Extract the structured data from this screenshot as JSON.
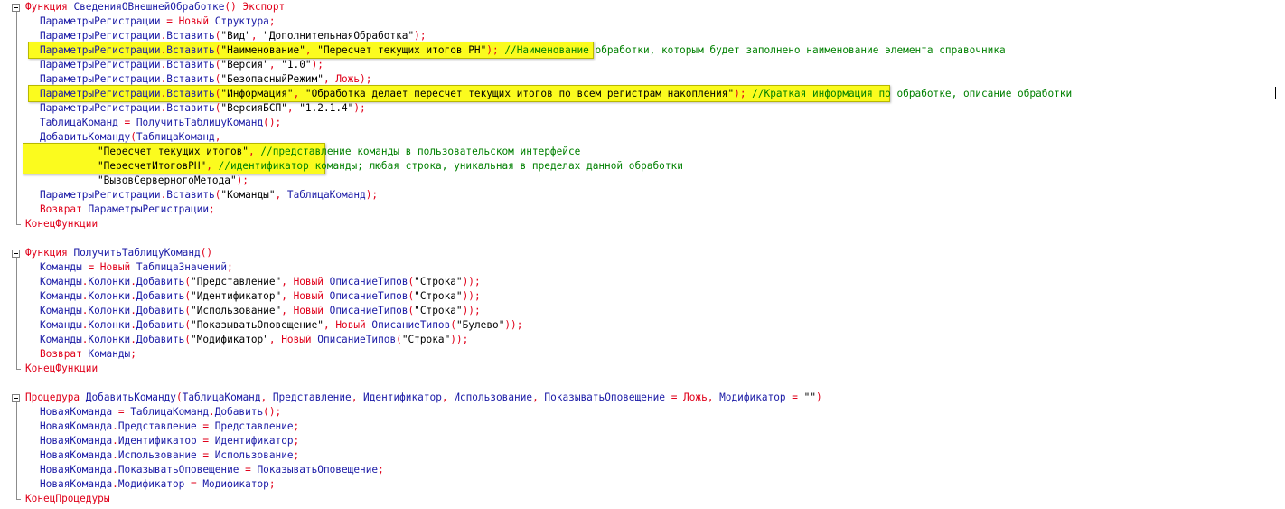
{
  "lines": [
    [
      [
        "kw",
        "Функция "
      ],
      [
        "id",
        "СведенияОВнешнейОбработке"
      ],
      [
        "op",
        "() "
      ],
      [
        "kw",
        "Экспорт"
      ]
    ],
    [
      [
        "id",
        "ПараметрыРегистрации "
      ],
      [
        "op",
        "= "
      ],
      [
        "kw",
        "Новый "
      ],
      [
        "id",
        "Структура"
      ],
      [
        "op",
        ";"
      ]
    ],
    [
      [
        "id",
        "ПараметрыРегистрации"
      ],
      [
        "op",
        "."
      ],
      [
        "id",
        "Вставить"
      ],
      [
        "op",
        "("
      ],
      [
        "str",
        "\"Вид\""
      ],
      [
        "op",
        ", "
      ],
      [
        "str",
        "\"ДополнительнаяОбработка\""
      ],
      [
        "op",
        ");"
      ]
    ],
    [
      [
        "id",
        "ПараметрыРегистрации"
      ],
      [
        "op",
        "."
      ],
      [
        "id",
        "Вставить"
      ],
      [
        "op",
        "("
      ],
      [
        "str",
        "\"Наименование\""
      ],
      [
        "op",
        ", "
      ],
      [
        "str",
        "\"Пересчет текущих итогов РН\""
      ],
      [
        "op",
        ");"
      ],
      [
        "cm",
        " //Наименование обработки, которым будет заполнено наименование элемента справочника"
      ]
    ],
    [
      [
        "id",
        "ПараметрыРегистрации"
      ],
      [
        "op",
        "."
      ],
      [
        "id",
        "Вставить"
      ],
      [
        "op",
        "("
      ],
      [
        "str",
        "\"Версия\""
      ],
      [
        "op",
        ", "
      ],
      [
        "str",
        "\"1.0\""
      ],
      [
        "op",
        ");"
      ]
    ],
    [
      [
        "id",
        "ПараметрыРегистрации"
      ],
      [
        "op",
        "."
      ],
      [
        "id",
        "Вставить"
      ],
      [
        "op",
        "("
      ],
      [
        "str",
        "\"БезопасныйРежим\""
      ],
      [
        "op",
        ", "
      ],
      [
        "kw",
        "Ложь"
      ],
      [
        "op",
        ");"
      ]
    ],
    [
      [
        "id",
        "ПараметрыРегистрации"
      ],
      [
        "op",
        "."
      ],
      [
        "id",
        "Вставить"
      ],
      [
        "op",
        "("
      ],
      [
        "str",
        "\"Информация\""
      ],
      [
        "op",
        ", "
      ],
      [
        "str",
        "\"Обработка делает пересчет текущих итогов по всем регистрам накопления\""
      ],
      [
        "op",
        ");"
      ],
      [
        "cm",
        " //Краткая информация по обработке, описание обработки"
      ]
    ],
    [
      [
        "id",
        "ПараметрыРегистрации"
      ],
      [
        "op",
        "."
      ],
      [
        "id",
        "Вставить"
      ],
      [
        "op",
        "("
      ],
      [
        "str",
        "\"ВерсияБСП\""
      ],
      [
        "op",
        ", "
      ],
      [
        "str",
        "\"1.2.1.4\""
      ],
      [
        "op",
        ");"
      ]
    ],
    [
      [
        "id",
        "ТаблицаКоманд "
      ],
      [
        "op",
        "= "
      ],
      [
        "id",
        "ПолучитьТаблицуКоманд"
      ],
      [
        "op",
        "();"
      ]
    ],
    [
      [
        "id",
        "ДобавитьКоманду"
      ],
      [
        "op",
        "("
      ],
      [
        "id",
        "ТаблицаКоманд"
      ],
      [
        "op",
        ","
      ]
    ],
    [
      [
        "str",
        "\"Пересчет текущих итогов\""
      ],
      [
        "op",
        ", "
      ],
      [
        "cm",
        "//представление команды в пользовательском интерфейсе"
      ]
    ],
    [
      [
        "str",
        "\"ПересчетИтоговРН\""
      ],
      [
        "op",
        ", "
      ],
      [
        "cm",
        "//идентификатор команды; любая строка, уникальная в пределах данной обработки"
      ]
    ],
    [
      [
        "str",
        "\"ВызовСерверногоМетода\""
      ],
      [
        "op",
        ");"
      ]
    ],
    [
      [
        "id",
        "ПараметрыРегистрации"
      ],
      [
        "op",
        "."
      ],
      [
        "id",
        "Вставить"
      ],
      [
        "op",
        "("
      ],
      [
        "str",
        "\"Команды\""
      ],
      [
        "op",
        ", "
      ],
      [
        "id",
        "ТаблицаКоманд"
      ],
      [
        "op",
        ");"
      ]
    ],
    [
      [
        "kw",
        "Возврат "
      ],
      [
        "id",
        "ПараметрыРегистрации"
      ],
      [
        "op",
        ";"
      ]
    ],
    [
      [
        "kw",
        "КонецФункции"
      ]
    ],
    [],
    [
      [
        "kw",
        "Функция "
      ],
      [
        "id",
        "ПолучитьТаблицуКоманд"
      ],
      [
        "op",
        "()"
      ]
    ],
    [
      [
        "id",
        "Команды "
      ],
      [
        "op",
        "= "
      ],
      [
        "kw",
        "Новый "
      ],
      [
        "id",
        "ТаблицаЗначений"
      ],
      [
        "op",
        ";"
      ]
    ],
    [
      [
        "id",
        "Команды"
      ],
      [
        "op",
        "."
      ],
      [
        "id",
        "Колонки"
      ],
      [
        "op",
        "."
      ],
      [
        "id",
        "Добавить"
      ],
      [
        "op",
        "("
      ],
      [
        "str",
        "\"Представление\""
      ],
      [
        "op",
        ", "
      ],
      [
        "kw",
        "Новый "
      ],
      [
        "id",
        "ОписаниеТипов"
      ],
      [
        "op",
        "("
      ],
      [
        "str",
        "\"Строка\""
      ],
      [
        "op",
        "));"
      ]
    ],
    [
      [
        "id",
        "Команды"
      ],
      [
        "op",
        "."
      ],
      [
        "id",
        "Колонки"
      ],
      [
        "op",
        "."
      ],
      [
        "id",
        "Добавить"
      ],
      [
        "op",
        "("
      ],
      [
        "str",
        "\"Идентификатор\""
      ],
      [
        "op",
        ", "
      ],
      [
        "kw",
        "Новый "
      ],
      [
        "id",
        "ОписаниеТипов"
      ],
      [
        "op",
        "("
      ],
      [
        "str",
        "\"Строка\""
      ],
      [
        "op",
        "));"
      ]
    ],
    [
      [
        "id",
        "Команды"
      ],
      [
        "op",
        "."
      ],
      [
        "id",
        "Колонки"
      ],
      [
        "op",
        "."
      ],
      [
        "id",
        "Добавить"
      ],
      [
        "op",
        "("
      ],
      [
        "str",
        "\"Использование\""
      ],
      [
        "op",
        ", "
      ],
      [
        "kw",
        "Новый "
      ],
      [
        "id",
        "ОписаниеТипов"
      ],
      [
        "op",
        "("
      ],
      [
        "str",
        "\"Строка\""
      ],
      [
        "op",
        "));"
      ]
    ],
    [
      [
        "id",
        "Команды"
      ],
      [
        "op",
        "."
      ],
      [
        "id",
        "Колонки"
      ],
      [
        "op",
        "."
      ],
      [
        "id",
        "Добавить"
      ],
      [
        "op",
        "("
      ],
      [
        "str",
        "\"ПоказыватьОповещение\""
      ],
      [
        "op",
        ", "
      ],
      [
        "kw",
        "Новый "
      ],
      [
        "id",
        "ОписаниеТипов"
      ],
      [
        "op",
        "("
      ],
      [
        "str",
        "\"Булево\""
      ],
      [
        "op",
        "));"
      ]
    ],
    [
      [
        "id",
        "Команды"
      ],
      [
        "op",
        "."
      ],
      [
        "id",
        "Колонки"
      ],
      [
        "op",
        "."
      ],
      [
        "id",
        "Добавить"
      ],
      [
        "op",
        "("
      ],
      [
        "str",
        "\"Модификатор\""
      ],
      [
        "op",
        ", "
      ],
      [
        "kw",
        "Новый "
      ],
      [
        "id",
        "ОписаниеТипов"
      ],
      [
        "op",
        "("
      ],
      [
        "str",
        "\"Строка\""
      ],
      [
        "op",
        "));"
      ]
    ],
    [
      [
        "kw",
        "Возврат "
      ],
      [
        "id",
        "Команды"
      ],
      [
        "op",
        ";"
      ]
    ],
    [
      [
        "kw",
        "КонецФункции"
      ]
    ],
    [],
    [
      [
        "kw",
        "Процедура "
      ],
      [
        "id",
        "ДобавитьКоманду"
      ],
      [
        "op",
        "("
      ],
      [
        "id",
        "ТаблицаКоманд"
      ],
      [
        "op",
        ", "
      ],
      [
        "id",
        "Представление"
      ],
      [
        "op",
        ", "
      ],
      [
        "id",
        "Идентификатор"
      ],
      [
        "op",
        ", "
      ],
      [
        "id",
        "Использование"
      ],
      [
        "op",
        ", "
      ],
      [
        "id",
        "ПоказыватьОповещение "
      ],
      [
        "op",
        "= "
      ],
      [
        "kw",
        "Ложь"
      ],
      [
        "op",
        ", "
      ],
      [
        "id",
        "Модификатор "
      ],
      [
        "op",
        "= "
      ],
      [
        "str",
        "\"\""
      ],
      [
        "op",
        ")"
      ]
    ],
    [
      [
        "id",
        "НоваяКоманда "
      ],
      [
        "op",
        "= "
      ],
      [
        "id",
        "ТаблицаКоманд"
      ],
      [
        "op",
        "."
      ],
      [
        "id",
        "Добавить"
      ],
      [
        "op",
        "();"
      ]
    ],
    [
      [
        "id",
        "НоваяКоманда"
      ],
      [
        "op",
        "."
      ],
      [
        "id",
        "Представление "
      ],
      [
        "op",
        "= "
      ],
      [
        "id",
        "Представление"
      ],
      [
        "op",
        ";"
      ]
    ],
    [
      [
        "id",
        "НоваяКоманда"
      ],
      [
        "op",
        "."
      ],
      [
        "id",
        "Идентификатор "
      ],
      [
        "op",
        "= "
      ],
      [
        "id",
        "Идентификатор"
      ],
      [
        "op",
        ";"
      ]
    ],
    [
      [
        "id",
        "НоваяКоманда"
      ],
      [
        "op",
        "."
      ],
      [
        "id",
        "Использование "
      ],
      [
        "op",
        "= "
      ],
      [
        "id",
        "Использование"
      ],
      [
        "op",
        ";"
      ]
    ],
    [
      [
        "id",
        "НоваяКоманда"
      ],
      [
        "op",
        "."
      ],
      [
        "id",
        "ПоказыватьОповещение "
      ],
      [
        "op",
        "= "
      ],
      [
        "id",
        "ПоказыватьОповещение"
      ],
      [
        "op",
        ";"
      ]
    ],
    [
      [
        "id",
        "НоваяКоманда"
      ],
      [
        "op",
        "."
      ],
      [
        "id",
        "Модификатор "
      ],
      [
        "op",
        "= "
      ],
      [
        "id",
        "Модификатор"
      ],
      [
        "op",
        ";"
      ]
    ],
    [
      [
        "kw",
        "КонецПроцедуры"
      ]
    ]
  ],
  "colors": {
    "keyword": "#e0001a",
    "identifier": "#1a1aa6",
    "string": "#000000",
    "comment": "#008000",
    "highlight": "#fbfb1e",
    "background": "#ffffff"
  },
  "icons": [
    "fold-minus-icon"
  ]
}
